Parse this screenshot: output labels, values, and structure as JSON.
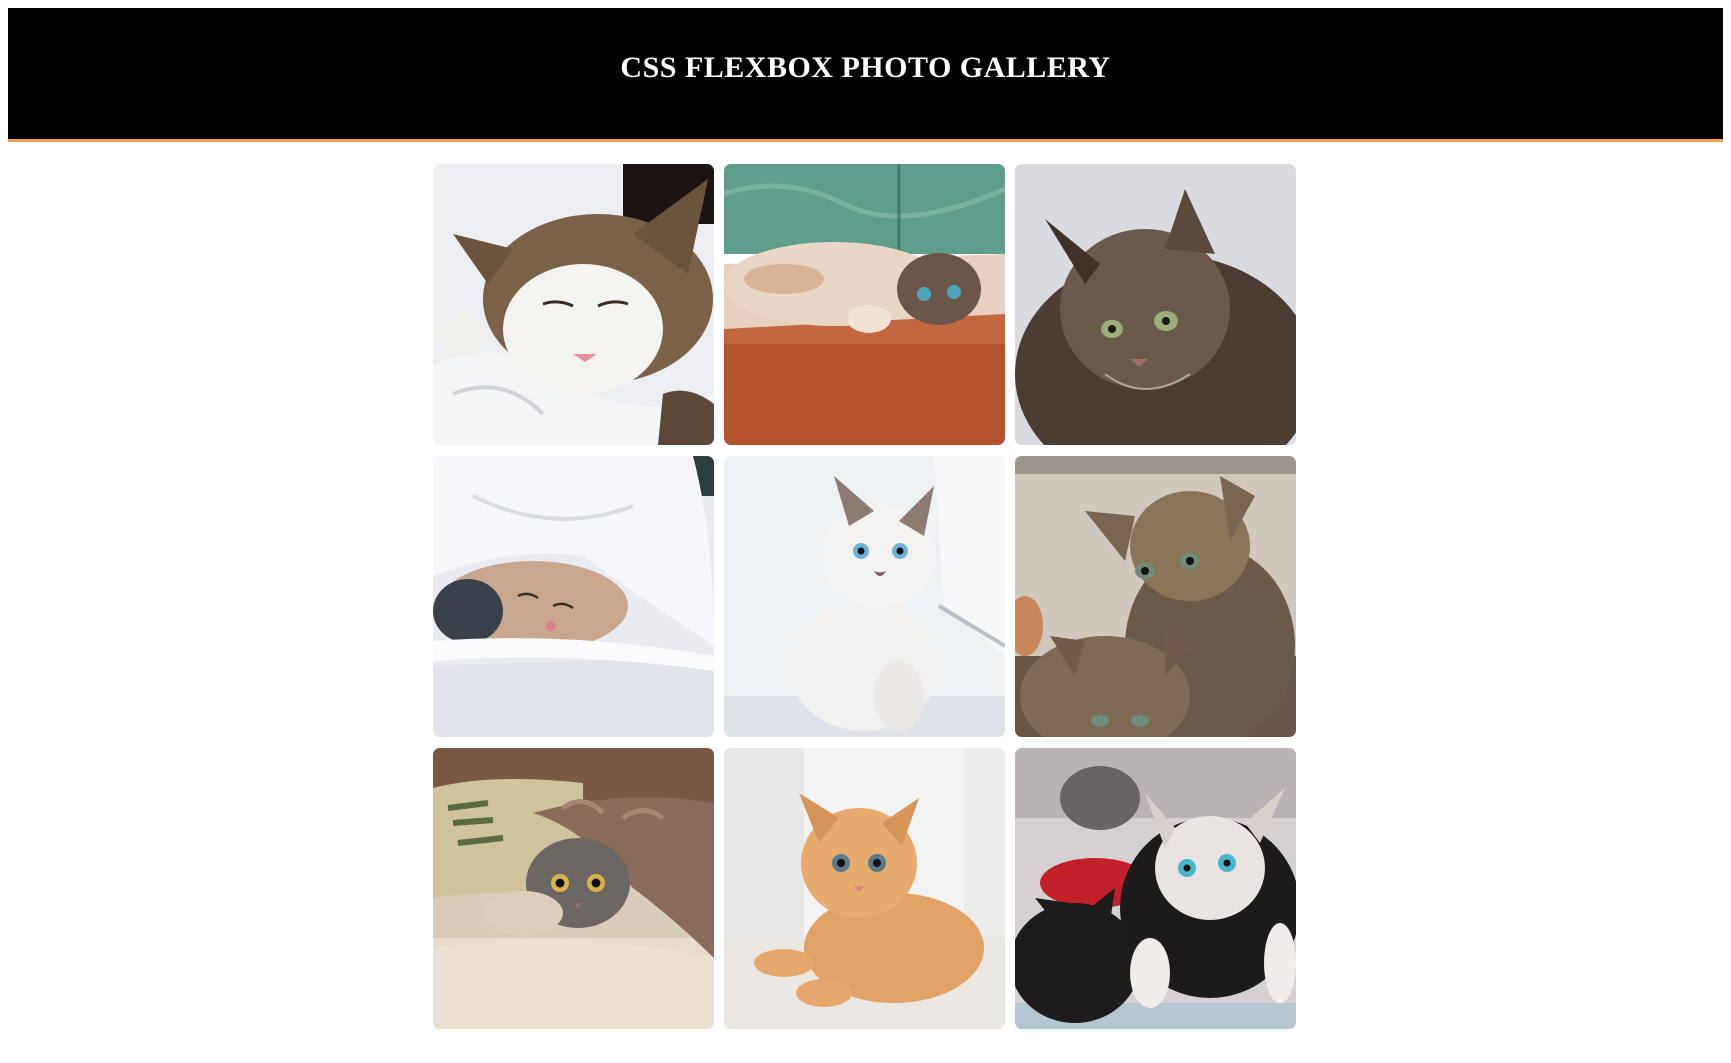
{
  "header": {
    "title": "CSS FLEXBOX PHOTO GALLERY",
    "background": "#000000",
    "accent_border": "#f0a04b",
    "title_color": "#ffffff"
  },
  "gallery": {
    "photos": [
      {
        "name": "sleeping-tabby-white-cat-photo"
      },
      {
        "name": "kitten-lying-upside-down-photo"
      },
      {
        "name": "long-haired-tabby-cat-photo"
      },
      {
        "name": "kitten-under-blanket-photo"
      },
      {
        "name": "white-siamese-kitten-photo"
      },
      {
        "name": "two-tabby-kittens-photo"
      },
      {
        "name": "kitten-under-rug-photo"
      },
      {
        "name": "orange-kitten-photo"
      },
      {
        "name": "white-and-black-kittens-photo"
      }
    ]
  }
}
